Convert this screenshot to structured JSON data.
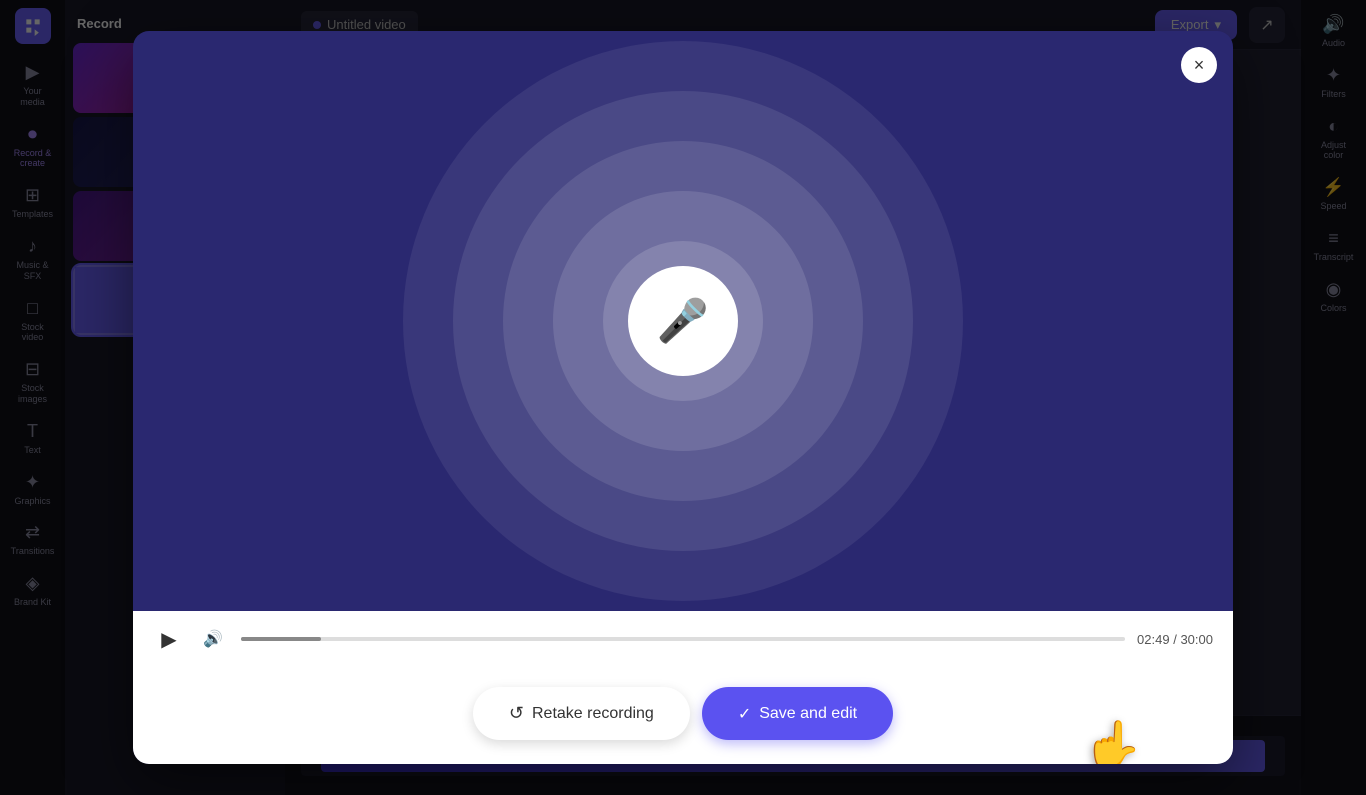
{
  "app": {
    "title": "Record"
  },
  "header": {
    "tab_label": "Untitled video",
    "export_label": "Export",
    "share_icon": "↗"
  },
  "left_sidebar": {
    "items": [
      {
        "id": "your-media",
        "label": "Your media",
        "icon": "▶"
      },
      {
        "id": "record-create",
        "label": "Record & create",
        "icon": "⏺"
      },
      {
        "id": "templates",
        "label": "Templates",
        "icon": "⊞"
      },
      {
        "id": "music-sfx",
        "label": "Music & SFX",
        "icon": "♪"
      },
      {
        "id": "stock-video",
        "label": "Stock video",
        "icon": "□"
      },
      {
        "id": "stock-images",
        "label": "Stock images",
        "icon": "⊟"
      },
      {
        "id": "text",
        "label": "Text",
        "icon": "T"
      },
      {
        "id": "graphics",
        "label": "Graphics",
        "icon": "✦"
      },
      {
        "id": "transitions",
        "label": "Transitions",
        "icon": "⇄"
      },
      {
        "id": "brand-kit",
        "label": "Brand Kit",
        "icon": "◈"
      }
    ]
  },
  "right_sidebar": {
    "items": [
      {
        "id": "audio",
        "label": "Audio",
        "icon": "🔊"
      },
      {
        "id": "filters",
        "label": "Filters",
        "icon": "✦"
      },
      {
        "id": "adjust",
        "label": "Adjust color",
        "icon": "◐"
      },
      {
        "id": "speed",
        "label": "Speed",
        "icon": "⚡"
      },
      {
        "id": "transcript",
        "label": "Transcript",
        "icon": "≡"
      },
      {
        "id": "colors",
        "label": "Colors",
        "icon": "◉"
      }
    ]
  },
  "modal": {
    "close_icon": "×",
    "circles_count": 5,
    "mic_icon": "🎤",
    "player": {
      "play_icon": "▶",
      "volume_icon": "🔊",
      "current_time": "02:49",
      "total_time": "30:00",
      "progress_percent": 9
    },
    "buttons": {
      "retake_label": "Retake recording",
      "retake_icon": "↺",
      "save_label": "Save and edit",
      "save_icon": "✓"
    }
  },
  "colors": {
    "modal_bg": "#4a45c8",
    "sidebar_bg": "#111118",
    "accent": "#5b52f0",
    "white": "#ffffff"
  }
}
